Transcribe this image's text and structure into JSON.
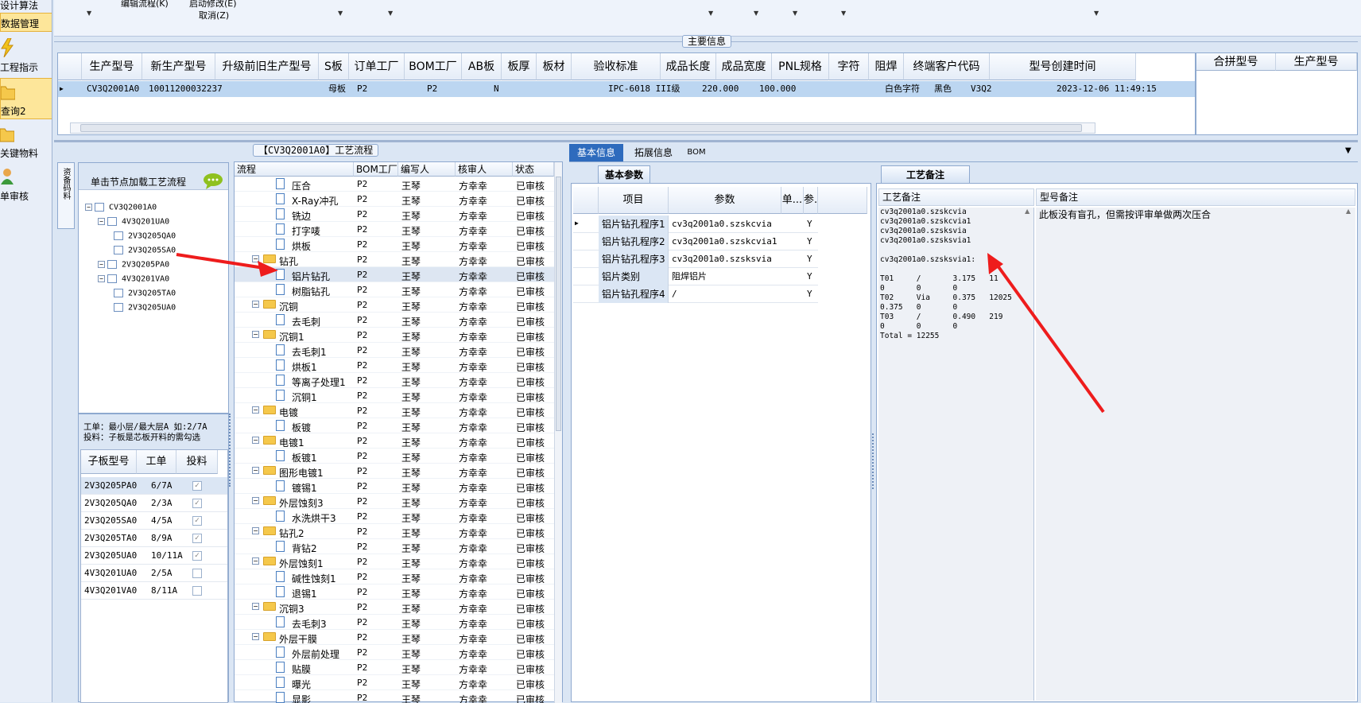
{
  "left_nav": {
    "items": [
      {
        "label": "设计算法"
      },
      {
        "label": "数据管理"
      },
      {
        "label": "工程指示"
      },
      {
        "label": "查询2"
      },
      {
        "label": "关键物料"
      },
      {
        "label": "单审核"
      }
    ]
  },
  "toolbar": {
    "edit_flow": "编辑流程(K)",
    "start_edit": "启动修改(E)",
    "cancel": "取消(Z)"
  },
  "main_info": {
    "title": "主要信息",
    "columns": [
      "生产型号",
      "新生产型号",
      "升级前旧生产型号",
      "S板",
      "订单工厂",
      "BOM工厂",
      "AB板",
      "板厚",
      "板材",
      "验收标准",
      "成品长度",
      "成品宽度",
      "PNL规格",
      "字符",
      "阻焊",
      "终端客户代码",
      "型号创建时间"
    ],
    "row": [
      "CV3Q2001A0",
      "10011200032237",
      "",
      "母板",
      "P2",
      "P2",
      "N",
      "",
      "",
      "IPC-6018 III级",
      "220.000",
      "100.000",
      "",
      "白色字符",
      "黑色",
      "V3Q2",
      "2023-12-06 11:49:15"
    ],
    "merge_columns": [
      "合拼型号",
      "生产型号"
    ]
  },
  "flow": {
    "title": "【CV3Q2001A0】工艺流程",
    "hint": "单击节点加载工艺流程",
    "side_tab": "资备码料",
    "tree": [
      "CV3Q2001A0",
      "4V3Q201UA0",
      "2V3Q205QA0",
      "2V3Q205SA0",
      "2V3Q205PA0",
      "4V3Q201VA0",
      "2V3Q205TA0",
      "2V3Q205UA0"
    ],
    "note": [
      "工单：最小层/最大层A 如:2/7A",
      "投料：子板是芯板开料的需勾选"
    ],
    "sub_cols": [
      "子板型号",
      "工单",
      "投料"
    ],
    "sub_rows": [
      [
        "2V3Q205PA0",
        "6/7A",
        "✓"
      ],
      [
        "2V3Q205QA0",
        "2/3A",
        "✓"
      ],
      [
        "2V3Q205SA0",
        "4/5A",
        "✓"
      ],
      [
        "2V3Q205TA0",
        "8/9A",
        "✓"
      ],
      [
        "2V3Q205UA0",
        "10/11A",
        "✓"
      ],
      [
        "4V3Q201UA0",
        "2/5A",
        ""
      ],
      [
        "4V3Q201VA0",
        "8/11A",
        ""
      ]
    ],
    "list_cols": [
      "流程",
      "BOM工厂",
      "编写人",
      "核审人",
      "状态"
    ],
    "steps": [
      {
        "name": "压合",
        "type": "doc",
        "lvl": 1
      },
      {
        "name": "X-Ray冲孔",
        "type": "doc",
        "lvl": 1
      },
      {
        "name": "铣边",
        "type": "doc",
        "lvl": 1
      },
      {
        "name": "打字唛",
        "type": "doc",
        "lvl": 1
      },
      {
        "name": "烘板",
        "type": "doc",
        "lvl": 1
      },
      {
        "name": "钻孔",
        "type": "folder",
        "lvl": 0
      },
      {
        "name": "铝片钻孔",
        "type": "doc",
        "lvl": 1
      },
      {
        "name": "树脂钻孔",
        "type": "doc",
        "lvl": 1
      },
      {
        "name": "沉铜",
        "type": "folder",
        "lvl": 0
      },
      {
        "name": "去毛刺",
        "type": "doc",
        "lvl": 1
      },
      {
        "name": "沉铜1",
        "type": "folder",
        "lvl": 0
      },
      {
        "name": "去毛刺1",
        "type": "doc",
        "lvl": 1
      },
      {
        "name": "烘板1",
        "type": "doc",
        "lvl": 1
      },
      {
        "name": "等离子处理1",
        "type": "doc",
        "lvl": 1
      },
      {
        "name": "沉铜1",
        "type": "doc",
        "lvl": 1
      },
      {
        "name": "电镀",
        "type": "folder",
        "lvl": 0
      },
      {
        "name": "板镀",
        "type": "doc",
        "lvl": 1
      },
      {
        "name": "电镀1",
        "type": "folder",
        "lvl": 0
      },
      {
        "name": "板镀1",
        "type": "doc",
        "lvl": 1
      },
      {
        "name": "图形电镀1",
        "type": "folder",
        "lvl": 0
      },
      {
        "name": "镀锡1",
        "type": "doc",
        "lvl": 1
      },
      {
        "name": "外层蚀刻3",
        "type": "folder",
        "lvl": 0
      },
      {
        "name": "水洗烘干3",
        "type": "doc",
        "lvl": 1
      },
      {
        "name": "钻孔2",
        "type": "folder",
        "lvl": 0
      },
      {
        "name": "背钻2",
        "type": "doc",
        "lvl": 1
      },
      {
        "name": "外层蚀刻1",
        "type": "folder",
        "lvl": 0
      },
      {
        "name": "碱性蚀刻1",
        "type": "doc",
        "lvl": 1
      },
      {
        "name": "退锡1",
        "type": "doc",
        "lvl": 1
      },
      {
        "name": "沉铜3",
        "type": "folder",
        "lvl": 0
      },
      {
        "name": "去毛刺3",
        "type": "doc",
        "lvl": 1
      },
      {
        "name": "外层干膜",
        "type": "folder",
        "lvl": 0
      },
      {
        "name": "外层前处理",
        "type": "doc",
        "lvl": 1
      },
      {
        "name": "贴膜",
        "type": "doc",
        "lvl": 1
      },
      {
        "name": "曝光",
        "type": "doc",
        "lvl": 1
      },
      {
        "name": "显影",
        "type": "doc",
        "lvl": 1
      }
    ],
    "bom": "P2",
    "writer": "王琴",
    "reviewer": "方幸幸",
    "status": "已审核"
  },
  "tabs": [
    "基本信息",
    "拓展信息",
    "BOM"
  ],
  "basic": {
    "title": "基本参数",
    "cols": [
      "项目",
      "参数",
      "单...",
      "参."
    ],
    "rows": [
      [
        "铝片钻孔程序1",
        "cv3q2001a0.szskcvia",
        "Y"
      ],
      [
        "铝片钻孔程序2",
        "cv3q2001a0.szskcvia1",
        "Y"
      ],
      [
        "铝片钻孔程序3",
        "cv3q2001a0.szsksvia",
        "Y"
      ],
      [
        "铝片类别",
        "阻焊铝片",
        "Y"
      ],
      [
        "铝片钻孔程序4",
        "/",
        "Y"
      ]
    ]
  },
  "remark": {
    "title": "工艺备注",
    "col1": "工艺备注",
    "col2": "型号备注",
    "lines": [
      "cv3q2001a0.szskcvia",
      "cv3q2001a0.szskcvia1",
      "cv3q2001a0.szsksvia",
      "cv3q2001a0.szsksvia1",
      "",
      "cv3q2001a0.szsksvia1:",
      "",
      "T01     /       3.175   11",
      "0       0       0",
      "T02     Via     0.375   12025",
      "0.375   0       0",
      "T03     /       0.490   219",
      "0       0       0",
      "Total = 12255"
    ],
    "model_note": "此板没有盲孔，但需按评审单做两次压合"
  }
}
